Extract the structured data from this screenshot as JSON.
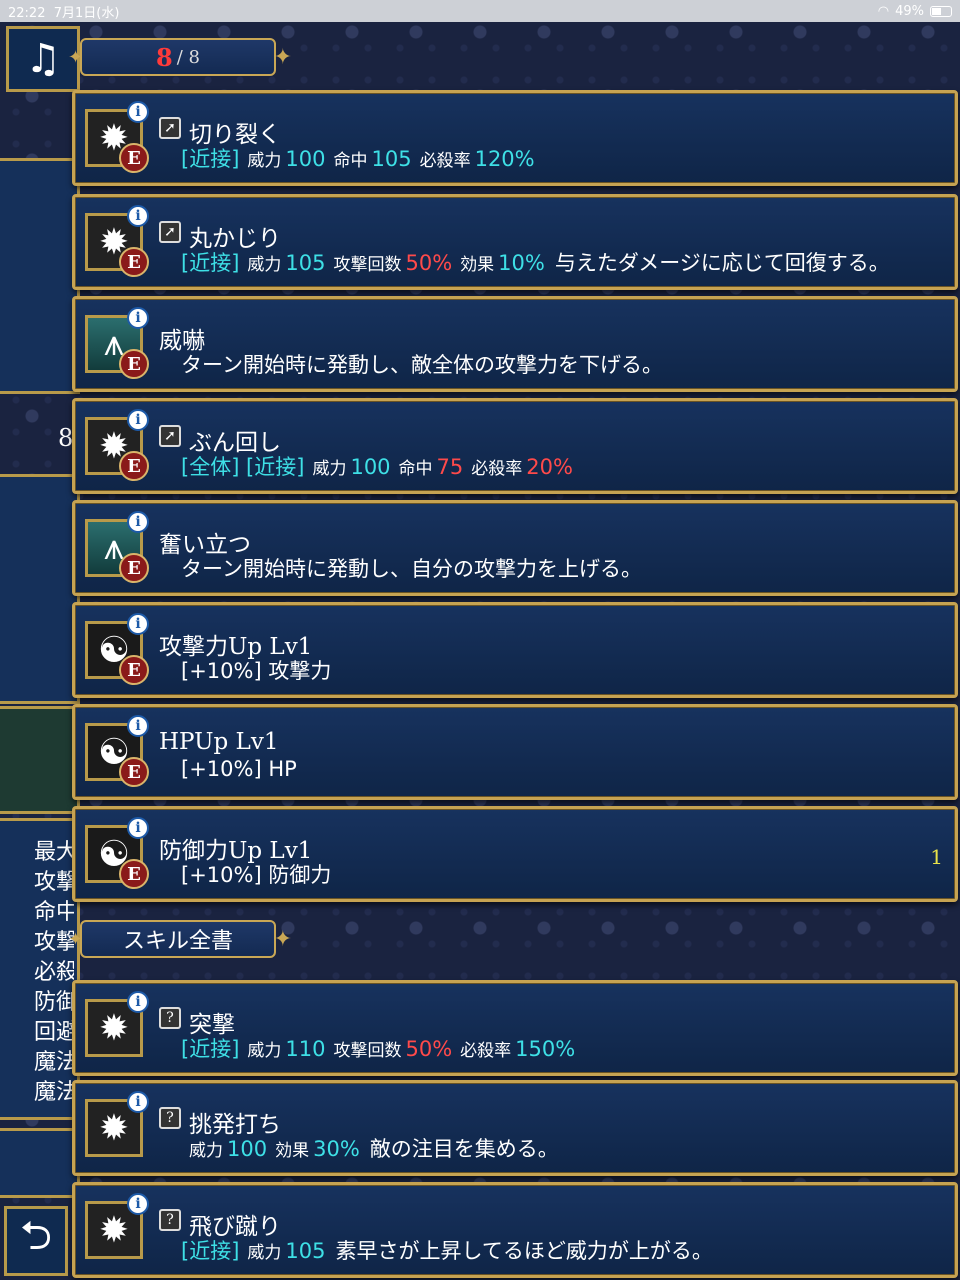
{
  "status": {
    "time": "22:22",
    "date": "7月1日(水)",
    "battery": "49%"
  },
  "header": {
    "equipped_current": "8",
    "equipped_total": "/ 8",
    "skillbook_title": "スキル全書"
  },
  "side": {
    "number": "8",
    "stats": [
      "最大",
      "攻撃",
      "命中",
      "攻撃",
      "必殺",
      "防御",
      "回避",
      "魔法",
      "魔法"
    ]
  },
  "icons": {
    "music": "music-note-icon",
    "back": "back-arrow-icon"
  },
  "colors": {
    "cyan": "#3ee0e6",
    "red": "#ff4a4a",
    "gold": "#c6a352"
  },
  "equipped": [
    {
      "name": "切り裂く",
      "type": "attack",
      "tags": "[近接]",
      "stats": [
        {
          "label": "威力",
          "value": "100",
          "color": "cyan"
        },
        {
          "label": "命中",
          "value": "105",
          "color": "cyan"
        },
        {
          "label": "必殺率",
          "value": "120%",
          "color": "cyan"
        }
      ],
      "desc": ""
    },
    {
      "name": "丸かじり",
      "type": "attack",
      "tags": "[近接]",
      "stats": [
        {
          "label": "威力",
          "value": "105",
          "color": "cyan"
        },
        {
          "label": "攻撃回数",
          "value": "50%",
          "color": "red"
        },
        {
          "label": "効果",
          "value": "10%",
          "color": "cyan"
        }
      ],
      "desc": "与えたダメージに応じて回復する。"
    },
    {
      "name": "威嚇",
      "type": "buff",
      "tags": "",
      "stats": [],
      "desc": "ターン開始時に発動し、敵全体の攻撃力を下げる。"
    },
    {
      "name": "ぶん回し",
      "type": "attack",
      "tags": "[全体] [近接]",
      "stats": [
        {
          "label": "威力",
          "value": "100",
          "color": "cyan"
        },
        {
          "label": "命中",
          "value": "75",
          "color": "red"
        },
        {
          "label": "必殺率",
          "value": "20%",
          "color": "red"
        }
      ],
      "desc": ""
    },
    {
      "name": "奮い立つ",
      "type": "buff",
      "tags": "",
      "stats": [],
      "desc": "ターン開始時に発動し、自分の攻撃力を上げる。"
    },
    {
      "name": "攻撃力Up Lv1",
      "type": "passive",
      "tags": "",
      "stats": [],
      "desc": "[+10%] 攻撃力"
    },
    {
      "name": "HPUp Lv1",
      "type": "passive",
      "tags": "",
      "stats": [],
      "desc": "[+10%] HP"
    },
    {
      "name": "防御力Up Lv1",
      "type": "passive",
      "tags": "",
      "stats": [],
      "desc": "[+10%] 防御力",
      "count": "1"
    }
  ],
  "skillbook": [
    {
      "name": "突撃",
      "tags": "[近接]",
      "stats": [
        {
          "label": "威力",
          "value": "110",
          "color": "cyan"
        },
        {
          "label": "攻撃回数",
          "value": "50%",
          "color": "red"
        },
        {
          "label": "必殺率",
          "value": "150%",
          "color": "cyan"
        }
      ],
      "desc": ""
    },
    {
      "name": "挑発打ち",
      "tags": "",
      "stats": [
        {
          "label": "威力",
          "value": "100",
          "color": "cyan"
        },
        {
          "label": "効果",
          "value": "30%",
          "color": "cyan"
        }
      ],
      "desc": "敵の注目を集める。"
    },
    {
      "name": "飛び蹴り",
      "tags": "[近接]",
      "stats": [
        {
          "label": "威力",
          "value": "105",
          "color": "cyan"
        }
      ],
      "desc": "素早さが上昇してるほど威力が上がる。"
    }
  ]
}
